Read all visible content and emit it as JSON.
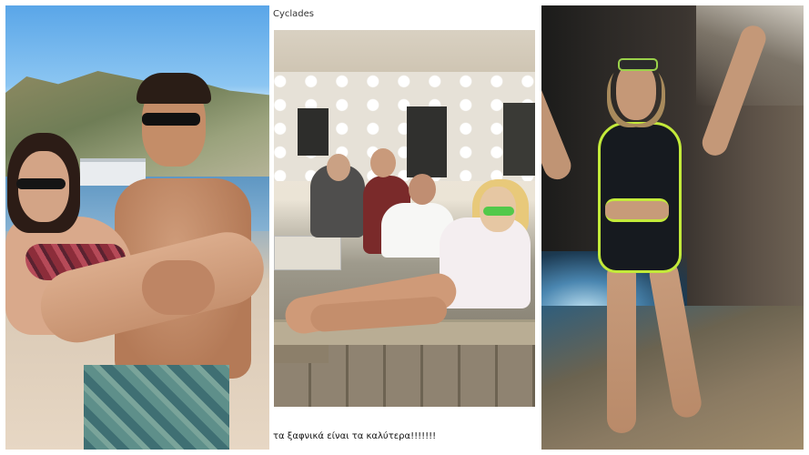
{
  "panels": {
    "left": {
      "scene": "beach-couple"
    },
    "middle": {
      "caption": "Cyclades",
      "footer_text": "τα ξαφνικά είναι τα καλύτερα!!!!!!!"
    },
    "right": {
      "scene": "cave-swimsuit"
    }
  },
  "colors": {
    "background": "#ffffff",
    "sky": "#5aa6e8",
    "swimsuit_accent": "#c3ea3a",
    "mid_sunglasses": "#52c94a"
  }
}
